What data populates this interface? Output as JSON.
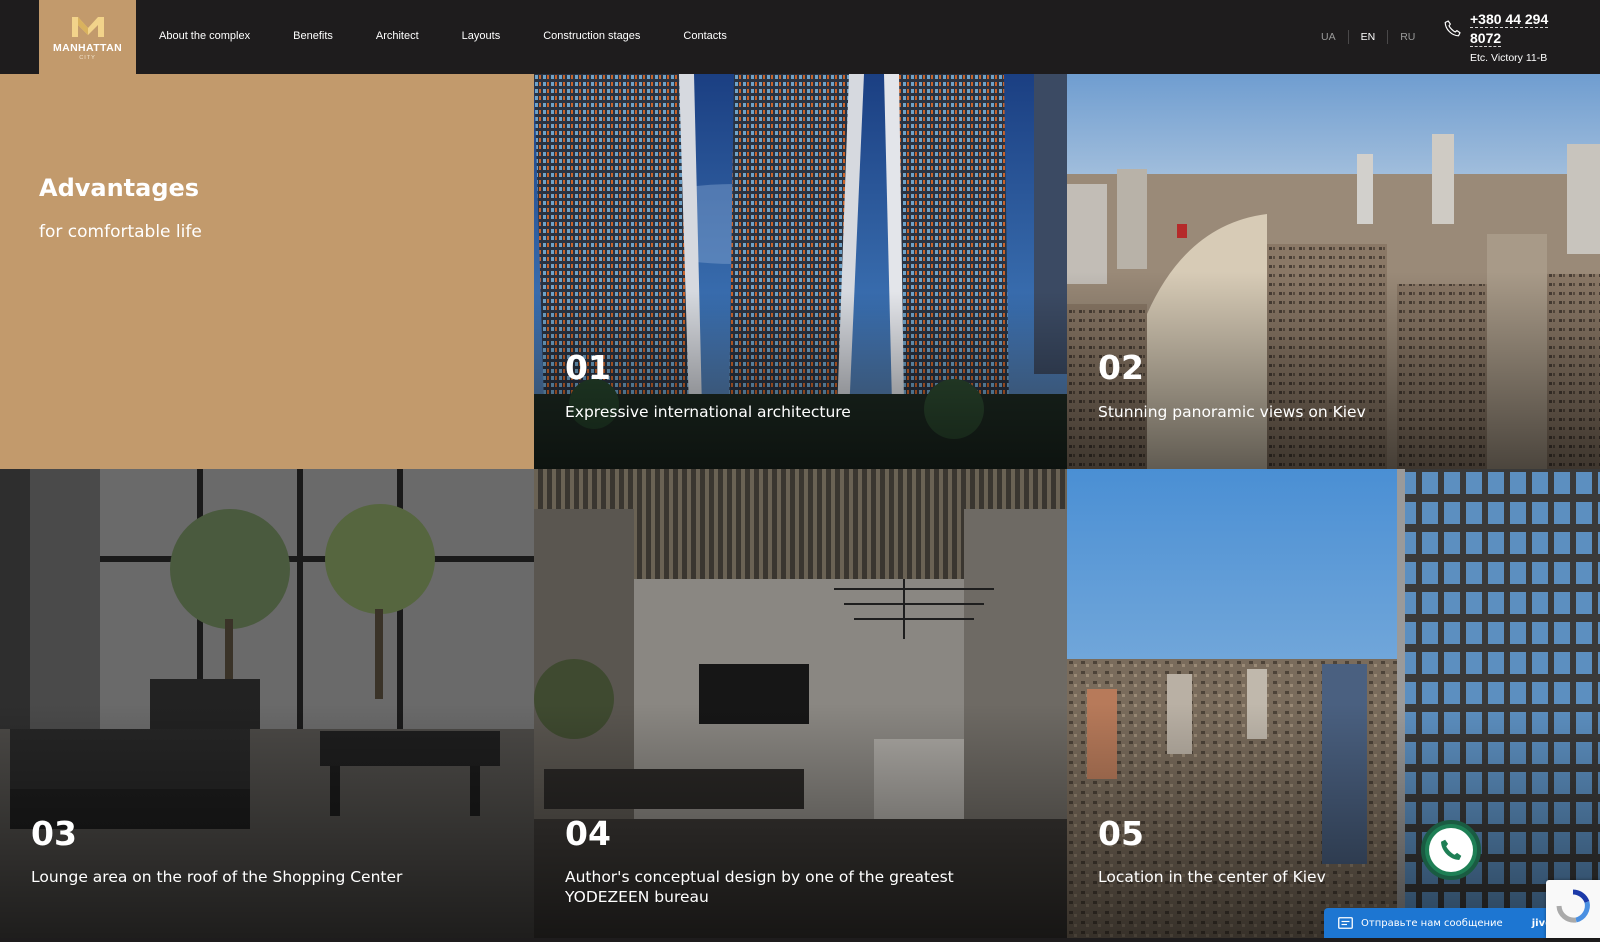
{
  "header": {
    "logo": {
      "text": "MANHATTAN",
      "sub": "CITY"
    },
    "nav": [
      "About the complex",
      "Benefits",
      "Architect",
      "Layouts",
      "Construction stages",
      "Contacts"
    ],
    "languages": [
      "UA",
      "EN",
      "RU"
    ],
    "active_language": "EN",
    "phone": "+380 44 294 8072",
    "address": "Etc. Victory 11-B"
  },
  "intro": {
    "title": "Advantages",
    "subtitle": "for comfortable life"
  },
  "advantages": [
    {
      "number": "01",
      "label": "Expressive international architecture"
    },
    {
      "number": "02",
      "label": "Stunning panoramic views on Kiev"
    },
    {
      "number": "03",
      "label": "Lounge area on the roof of the Shopping Center"
    },
    {
      "number": "04",
      "label": "Author's conceptual design by one of the greatest YODEZEEN bureau"
    },
    {
      "number": "05",
      "label": "Location in the center of Kiev"
    }
  ],
  "chat": {
    "text": "Отправьте нам сообщение",
    "brand": "jivo"
  },
  "colors": {
    "accent": "#c29a6c",
    "header_bg": "#1e1c1d",
    "call_button": "#1e7f55",
    "chat_bar": "#1d76d2"
  },
  "icons": {
    "phone": "phone-icon",
    "call": "call-button-icon",
    "chat": "chat-icon"
  }
}
